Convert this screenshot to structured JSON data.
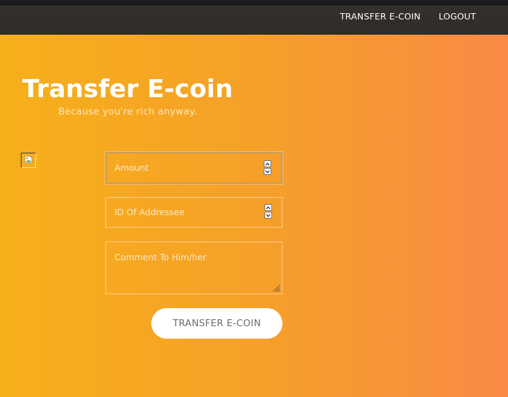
{
  "nav": {
    "items": [
      {
        "label": "TRANSFER E-COIN"
      },
      {
        "label": "LOGOUT"
      }
    ]
  },
  "hero": {
    "title": "Transfer E-coin",
    "subtitle": "Because you're rich anyway."
  },
  "form": {
    "amount_placeholder": "Amount",
    "addressee_placeholder": "ID Of Addressee",
    "comment_placeholder": "Comment To Him/her",
    "submit_label": "TRANSFER E-COIN"
  },
  "icons": {
    "broken_image": "broken-image-icon",
    "spinner_up": "chevron-up-icon",
    "spinner_down": "chevron-down-icon",
    "resize": "resize-grip-icon"
  },
  "colors": {
    "gradient_start": "#f6b01a",
    "gradient_end": "#f98a46",
    "topbar": "#2f2c28",
    "button_bg": "#ffffff",
    "button_text": "#6c6c6c"
  }
}
